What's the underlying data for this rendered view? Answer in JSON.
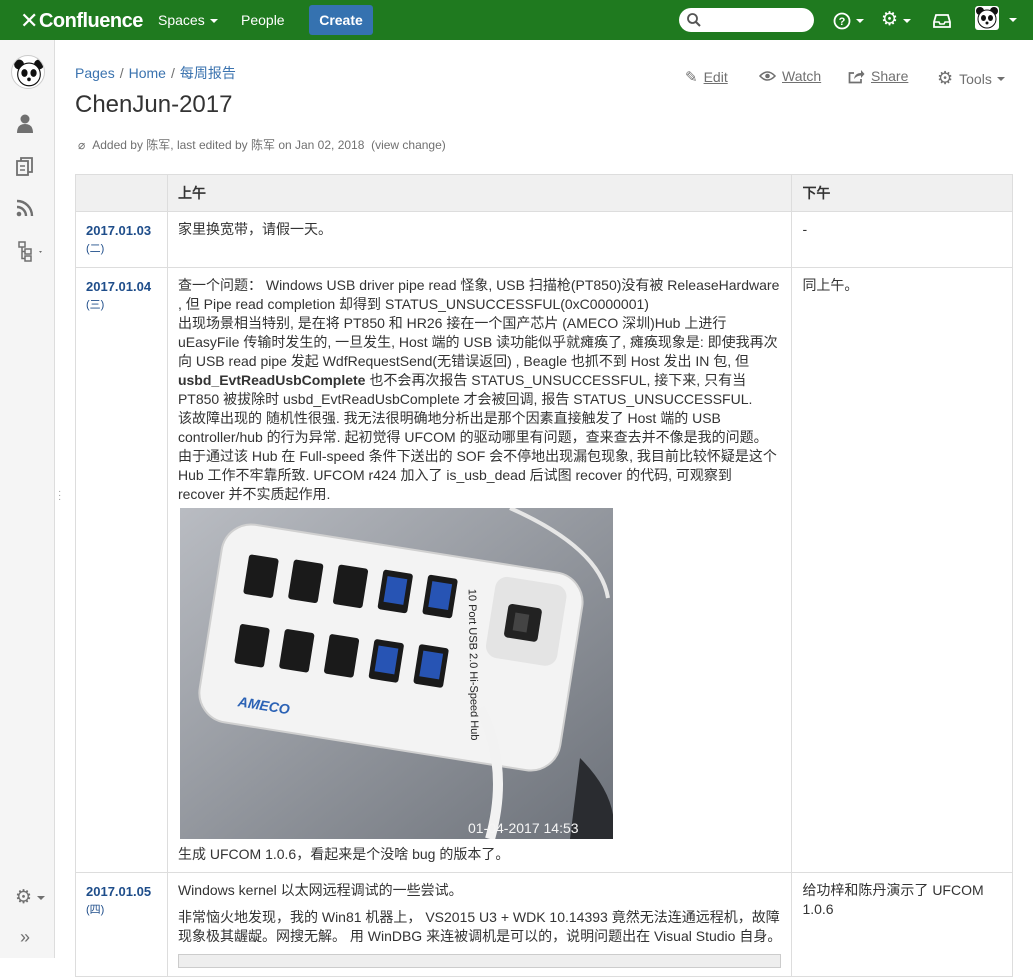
{
  "topbar": {
    "brand": "Confluence",
    "nav": [
      "Spaces",
      "People"
    ],
    "create_label": "Create",
    "search_placeholder": "",
    "bg_color": "#1f7a1f",
    "create_color": "#3572b0"
  },
  "breadcrumb": [
    "Pages",
    "Home",
    "每周报告"
  ],
  "page": {
    "title": "ChenJun-2017",
    "meta_prefix": "Added by 陈军, last edited by 陈军 on Jan 02, 2018",
    "meta_link": "(view change)"
  },
  "actions": {
    "edit": "Edit",
    "watch": "Watch",
    "share": "Share",
    "tools": "Tools"
  },
  "table": {
    "headers": [
      "",
      "上午",
      "下午"
    ],
    "rows": [
      {
        "date": "2017.01.03",
        "dow": "(二)",
        "am": "家里换宽带，请假一天。",
        "pm": "-"
      },
      {
        "date": "2017.01.04",
        "dow": "(三)",
        "am_1": "查一个问题： Windows USB driver pipe read 怪象, USB 扫描枪(PT850)没有被 ReleaseHardware , 但 Pipe read completion 却得到 STATUS_UNSUCCESSFUL(0xC0000001)",
        "am_2": "出现场景相当特别, 是在将 PT850 和 HR26 接在一个国产芯片 (AMECO 深圳)Hub 上进行 uEasyFile 传输时发生的, 一旦发生, Host 端的 USB 读功能似乎就瘫痪了, 瘫痪现象是: 即使我再次向 USB read pipe 发起 WdfRequestSend(无错误返回) , Beagle 也抓不到 Host 发出 IN 包, 但",
        "am_bold": "usbd_EvtReadUsbComplete",
        "am_3": " 也不会再次报告 STATUS_UNSUCCESSFUL, 接下来, 只有当 PT850 被拔除时 usbd_EvtReadUsbComplete 才会被回调, 报告 STATUS_UNSUCCESSFUL.",
        "am_4": "该故障出现的 随机性很强. 我无法很明确地分析出是那个因素直接触发了 Host 端的 USB controller/hub 的行为异常. 起初觉得 UFCOM 的驱动哪里有问题，查来查去并不像是我的问题。由于通过该 Hub 在 Full-speed 条件下送出的 SOF 会不停地出现漏包现象, 我目前比较怀疑是这个 Hub 工作不牢靠所致. UFCOM r424 加入了 is_usb_dead 后试图 recover 的代码, 可观察到 recover 并不实质起作用.",
        "photo_hub_label": "10 Port USB 2.0 Hi-Speed Hub",
        "photo_brand": "AMECO",
        "photo_timestamp": "01-04-2017 14:53",
        "am_5": "生成 UFCOM 1.0.6，看起来是个没啥 bug 的版本了。",
        "pm": "同上午。"
      },
      {
        "date": "2017.01.05",
        "dow": "(四)",
        "am_1": "Windows kernel 以太网远程调试的一些尝试。",
        "am_2": "非常恼火地发现，我的 Win81 机器上， VS2015 U3 + WDK 10.14393 竟然无法连通远程机，故障现象极其龌龊。网搜无解。 用 WinDBG 来连被调机是可以的，说明问题出在 Visual Studio 自身。",
        "pm": "给功梓和陈丹演示了 UFCOM 1.0.6"
      }
    ]
  }
}
